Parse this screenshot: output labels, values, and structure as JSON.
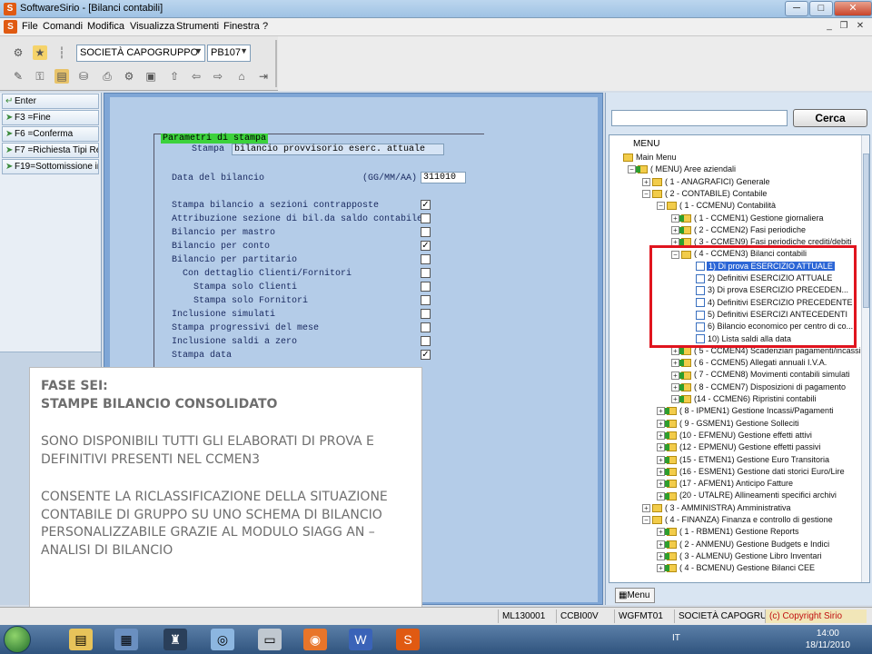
{
  "window": {
    "title": "SoftwareSirio - [Bilanci contabili]",
    "minimize": "─",
    "maximize": "□",
    "close": "✕"
  },
  "menu": {
    "items": [
      "File",
      "Comandi",
      "Modifica",
      "Visualizza",
      "Strumenti",
      "Finestra",
      "?"
    ],
    "mdi": [
      "_",
      "❐",
      "✕"
    ]
  },
  "toolbar": {
    "company": "SOCIETÀ CAPOGRUPPO",
    "code": "PB107"
  },
  "function_keys": [
    {
      "label": "Enter"
    },
    {
      "label": "F3  =Fine"
    },
    {
      "label": "F6  =Conferma"
    },
    {
      "label": "F7  =Richiesta Tipi Re"
    },
    {
      "label": "F19=Sottomissione in"
    }
  ],
  "form": {
    "title": "Parametri di stampa",
    "stampa_label": "Stampa",
    "stampa_value": "bilancio provvisorio eserc. attuale",
    "data_label": "Data del bilancio",
    "data_format": "(GG/MM/AA)",
    "data_value": "311010",
    "options": [
      {
        "label": "Stampa bilancio a sezioni contrapposte",
        "checked": "✓"
      },
      {
        "label": "Attribuzione sezione di bil.da saldo contabile",
        "checked": ""
      },
      {
        "label": "Bilancio per mastro",
        "checked": ""
      },
      {
        "label": "Bilancio per conto",
        "checked": "✓"
      },
      {
        "label": "Bilancio per partitario",
        "checked": ""
      },
      {
        "label": "Con dettaglio Clienti/Fornitori",
        "checked": ""
      },
      {
        "label": "Stampa solo Clienti",
        "checked": ""
      },
      {
        "label": "Stampa solo Fornitori",
        "checked": ""
      },
      {
        "label": "Inclusione simulati",
        "checked": ""
      },
      {
        "label": "Stampa progressivi del mese",
        "checked": ""
      },
      {
        "label": "Inclusione saldi a zero",
        "checked": ""
      },
      {
        "label": "Stampa data",
        "checked": "✓"
      }
    ]
  },
  "overlay": {
    "title_line1": "FASE SEI:",
    "title_line2": "STAMPE BILANCIO CONSOLIDATO",
    "para1": "SONO DISPONIBILI TUTTI GLI ELABORATI DI PROVA E DEFINITIVI PRESENTI NEL CCMEN3",
    "para2": "CONSENTE LA RICLASSIFICAZIONE DELLA SITUAZIONE CONTABILE DI GRUPPO SU UNO SCHEMA DI BILANCIO PERSONALIZZABILE GRAZIE AL MODULO SIAGG AN – ANALISI DI BILANCIO"
  },
  "search": {
    "placeholder": "",
    "button": "Cerca"
  },
  "tree": {
    "header": "MENU",
    "nodes": [
      {
        "label": "Main Menu",
        "level": 0,
        "icon": "folder",
        "pm": ""
      },
      {
        "label": "( MENU) Aree aziendali",
        "level": 1,
        "icon": "folder-green",
        "pm": "−"
      },
      {
        "label": "( 1 - ANAGRAFICI) Generale",
        "level": 2,
        "icon": "folder",
        "pm": "+"
      },
      {
        "label": "( 2 - CONTABILE) Contabile",
        "level": 2,
        "icon": "folder",
        "pm": "−"
      },
      {
        "label": "( 1 - CCMENU) Contabilità",
        "level": 3,
        "icon": "folder",
        "pm": "−"
      },
      {
        "label": "( 1 - CCMEN1) Gestione giornaliera",
        "level": 4,
        "icon": "folder-green",
        "pm": "+"
      },
      {
        "label": "( 2 - CCMEN2) Fasi periodiche",
        "level": 4,
        "icon": "folder-green",
        "pm": "+"
      },
      {
        "label": "( 3 - CCMEN9) Fasi periodiche crediti/debiti",
        "level": 4,
        "icon": "folder-green",
        "pm": "+"
      },
      {
        "label": "( 4 - CCMEN3) Bilanci contabili",
        "level": 4,
        "icon": "folder",
        "pm": "−"
      },
      {
        "label": "1) Di prova   ESERCIZIO ATTUALE",
        "level": 5,
        "icon": "doc",
        "pm": "",
        "selected": true
      },
      {
        "label": "2) Definitivi ESERCIZIO ATTUALE",
        "level": 5,
        "icon": "doc",
        "pm": ""
      },
      {
        "label": "3) Di prova    ESERCIZIO PRECEDEN...",
        "level": 5,
        "icon": "doc",
        "pm": ""
      },
      {
        "label": "4) Definitivi ESERCIZIO PRECEDENTE",
        "level": 5,
        "icon": "doc",
        "pm": ""
      },
      {
        "label": "5) Definitivi ESERCIZI ANTECEDENTI",
        "level": 5,
        "icon": "doc",
        "pm": ""
      },
      {
        "label": "6) Bilancio economico per centro di co...",
        "level": 5,
        "icon": "doc",
        "pm": ""
      },
      {
        "label": "10) Lista saldi alla data",
        "level": 5,
        "icon": "doc",
        "pm": ""
      },
      {
        "label": "( 5 - CCMEN4) Scadenziari pagamenti/incassi",
        "level": 4,
        "icon": "folder-green",
        "pm": "+"
      },
      {
        "label": "( 6 - CCMEN5) Allegati annuali I.V.A.",
        "level": 4,
        "icon": "folder-green",
        "pm": "+"
      },
      {
        "label": "( 7 - CCMEN8) Movimenti contabili simulati",
        "level": 4,
        "icon": "folder-green",
        "pm": "+"
      },
      {
        "label": "( 8 - CCMEN7) Disposizioni di pagamento",
        "level": 4,
        "icon": "folder-green",
        "pm": "+"
      },
      {
        "label": "(14 - CCMEN6) Ripristini contabili",
        "level": 4,
        "icon": "folder-green",
        "pm": "+"
      },
      {
        "label": "( 8 - IPMEN1) Gestione Incassi/Pagamenti",
        "level": 3,
        "icon": "folder-green",
        "pm": "+"
      },
      {
        "label": "( 9 - GSMEN1) Gestione Solleciti",
        "level": 3,
        "icon": "folder-green",
        "pm": "+"
      },
      {
        "label": "(10 - EFMENU) Gestione effetti attivi",
        "level": 3,
        "icon": "folder-green",
        "pm": "+"
      },
      {
        "label": "(12 - EPMENU) Gestione effetti passivi",
        "level": 3,
        "icon": "folder-green",
        "pm": "+"
      },
      {
        "label": "(15 - ETMEN1) Gestione Euro Transitoria",
        "level": 3,
        "icon": "folder-green",
        "pm": "+"
      },
      {
        "label": "(16 - ESMEN1) Gestione dati storici Euro/Lire",
        "level": 3,
        "icon": "folder-green",
        "pm": "+"
      },
      {
        "label": "(17 - AFMEN1) Anticipo Fatture",
        "level": 3,
        "icon": "folder-green",
        "pm": "+"
      },
      {
        "label": "(20 - UTALRE) Allineamenti specifici archivi",
        "level": 3,
        "icon": "folder-green",
        "pm": "+"
      },
      {
        "label": "( 3 - AMMINISTRA) Amministrativa",
        "level": 2,
        "icon": "folder",
        "pm": "+"
      },
      {
        "label": "( 4 - FINANZA) Finanza e controllo di gestione",
        "level": 2,
        "icon": "folder",
        "pm": "−"
      },
      {
        "label": "( 1 - RBMEN1) Gestione Reports",
        "level": 3,
        "icon": "folder-green",
        "pm": "+"
      },
      {
        "label": "( 2 - ANMENU) Gestione Budgets e Indici",
        "level": 3,
        "icon": "folder-green",
        "pm": "+"
      },
      {
        "label": "( 3 - ALMENU) Gestione Libro Inventari",
        "level": 3,
        "icon": "folder-green",
        "pm": "+"
      },
      {
        "label": "( 4 - BCMENU) Gestione Bilanci CEE",
        "level": 3,
        "icon": "folder-green",
        "pm": "+"
      }
    ],
    "tab_label": "Menu"
  },
  "statusbar": {
    "cells": [
      "ML130001",
      "CCBI00V",
      "WGFMT01",
      "SOCIETÀ CAPOGRUPP"
    ],
    "copyright": "(c) Copyright Sirio"
  },
  "taskbar": {
    "lang": "IT",
    "time": "14:00",
    "date": "18/11/2010"
  },
  "colors": {
    "accent": "#2c66d6",
    "highlight_box": "#e0141e",
    "form_title_bg": "#3cd23c"
  }
}
